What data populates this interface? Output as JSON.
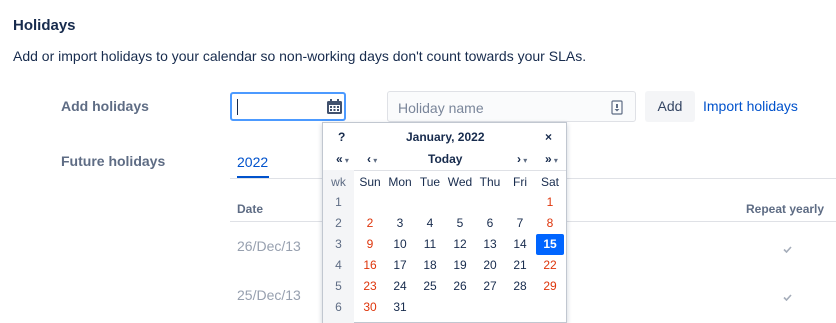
{
  "section": {
    "title": "Holidays",
    "description": "Add or import holidays to your calendar so non-working days don't count towards your SLAs."
  },
  "form": {
    "add_label": "Add holidays",
    "date_value": "",
    "name_placeholder": "Holiday name",
    "add_button": "Add",
    "import_link": "Import holidays",
    "date_icon": "calendar-icon",
    "name_icon": "dropdown-trigger-icon"
  },
  "future": {
    "label": "Future holidays",
    "tab": "2022",
    "columns": {
      "date": "Date",
      "repeat": "Repeat yearly"
    },
    "rows": [
      {
        "date": "26/Dec/13",
        "repeat": true
      },
      {
        "date": "25/Dec/13",
        "repeat": true
      }
    ]
  },
  "calendar": {
    "help": "?",
    "month": "January, 2022",
    "close": "×",
    "prev_year": "«",
    "prev_month": "‹",
    "today": "Today",
    "next_month": "›",
    "next_year": "»",
    "weekday_headers": [
      "wk",
      "Sun",
      "Mon",
      "Tue",
      "Wed",
      "Thu",
      "Fri",
      "Sat"
    ],
    "weeks": [
      {
        "wk": "1",
        "days": [
          "",
          "",
          "",
          "",
          "",
          "",
          "1"
        ]
      },
      {
        "wk": "2",
        "days": [
          "2",
          "3",
          "4",
          "5",
          "6",
          "7",
          "8"
        ]
      },
      {
        "wk": "3",
        "days": [
          "9",
          "10",
          "11",
          "12",
          "13",
          "14",
          "15"
        ]
      },
      {
        "wk": "4",
        "days": [
          "16",
          "17",
          "18",
          "19",
          "20",
          "21",
          "22"
        ]
      },
      {
        "wk": "5",
        "days": [
          "23",
          "24",
          "25",
          "26",
          "27",
          "28",
          "29"
        ]
      },
      {
        "wk": "6",
        "days": [
          "30",
          "31",
          "",
          "",
          "",
          "",
          ""
        ]
      }
    ],
    "selected_day": "15",
    "colors": {
      "weekend": "#de350b",
      "selected": "#0065ff",
      "link": "#0052cc"
    }
  }
}
